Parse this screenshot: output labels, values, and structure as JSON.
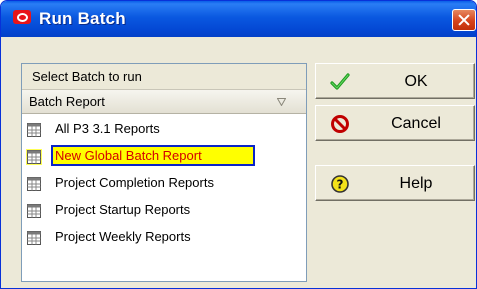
{
  "window": {
    "title": "Run Batch"
  },
  "panel": {
    "header": "Select Batch to run",
    "column_header": "Batch Report",
    "items": [
      {
        "label": "All P3 3.1 Reports",
        "selected": false
      },
      {
        "label": "New Global Batch Report",
        "selected": true
      },
      {
        "label": "Project Completion Reports",
        "selected": false
      },
      {
        "label": "Project Startup Reports",
        "selected": false
      },
      {
        "label": "Project Weekly Reports",
        "selected": false
      }
    ]
  },
  "buttons": {
    "ok": "OK",
    "cancel": "Cancel",
    "help": "Help"
  },
  "icons": {
    "app": "oracle-icon",
    "close": "close-icon",
    "ok": "checkmark-icon",
    "cancel": "no-entry-icon",
    "help": "question-icon",
    "report": "report-grid-icon"
  },
  "colors": {
    "selection_fill": "#ffff00",
    "selection_border": "#0a24c8",
    "selection_text": "#d40000"
  }
}
